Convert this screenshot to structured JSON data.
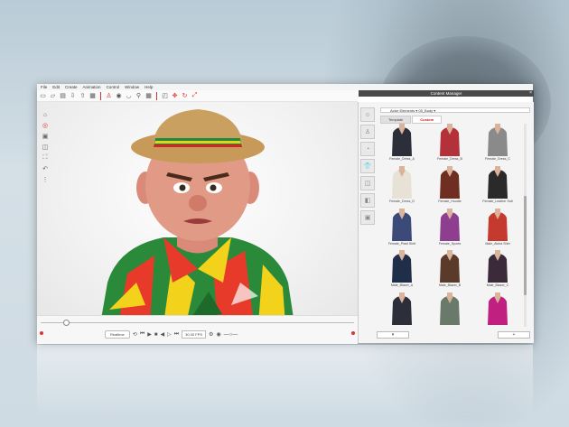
{
  "menu": [
    "File",
    "Edit",
    "Create",
    "Animation",
    "Control",
    "Window",
    "Help"
  ],
  "toolbar_icons": [
    "new-icon",
    "open-icon",
    "save-icon",
    "import-icon",
    "export-icon",
    "render-icon",
    "person-icon",
    "eye-icon",
    "mouth-icon",
    "walk-icon",
    "grid-icon",
    "select-icon",
    "move-icon",
    "rotate-icon",
    "scale-icon"
  ],
  "viewport_tools": [
    "home-icon",
    "target-icon",
    "image-icon",
    "split-icon",
    "fit-icon",
    "undo-icon",
    "dots-icon"
  ],
  "timeline": {
    "playback_mode": "Realtime",
    "fps": "30.00 FPS",
    "controls": [
      "rewind-icon",
      "play-icon",
      "stop-icon",
      "prev-icon",
      "next-icon",
      "end-icon"
    ]
  },
  "content_manager": {
    "title": "Content Manager",
    "path": "Actor Elements ▾ 05_Body ▾",
    "tabs": [
      "Template",
      "Custom"
    ],
    "active_tab": "Custom",
    "items": [
      {
        "label": "Female_Dress_A",
        "top": "#2c2f3a",
        "skin": "#d9b49a"
      },
      {
        "label": "Female_Dress_B",
        "top": "#b3323a",
        "skin": "#d9b49a"
      },
      {
        "label": "Female_Dress_C",
        "top": "#8a8a8a",
        "skin": "#d9b49a"
      },
      {
        "label": "Female_Dress_D",
        "top": "#e8e2d6",
        "skin": "#d9b49a"
      },
      {
        "label": "Female_Hoodie",
        "top": "#6e2f22",
        "skin": "#d9b49a"
      },
      {
        "label": "Female_Leather Suit",
        "top": "#2a2a2a",
        "skin": "#d9b49a"
      },
      {
        "label": "Female_Plaid Shirt",
        "top": "#3c4a7a",
        "skin": "#d9b49a"
      },
      {
        "label": "Female_Sports",
        "top": "#8e3e8e",
        "skin": "#d9b49a"
      },
      {
        "label": "Male_Aloha Shirt",
        "top": "#c43a2e",
        "skin": "#d9b49a"
      },
      {
        "label": "Male_Blazer_A",
        "top": "#1f2f4a",
        "skin": "#d9b49a"
      },
      {
        "label": "Male_Blazer_B",
        "top": "#5a3a2a",
        "skin": "#d9b49a"
      },
      {
        "label": "Male_Blazer_C",
        "top": "#3a2a3a",
        "skin": "#d9b49a"
      },
      {
        "label": "",
        "top": "#2c2f3a",
        "skin": "#d9b49a"
      },
      {
        "label": "",
        "top": "#6a7a6a",
        "skin": "#d9b49a"
      },
      {
        "label": "",
        "top": "#c02080",
        "skin": "#d9b49a"
      }
    ],
    "bottom_buttons": [
      "▾",
      "+"
    ]
  },
  "colors": {
    "accent": "#d33333",
    "panel": "#f4f4f4"
  }
}
